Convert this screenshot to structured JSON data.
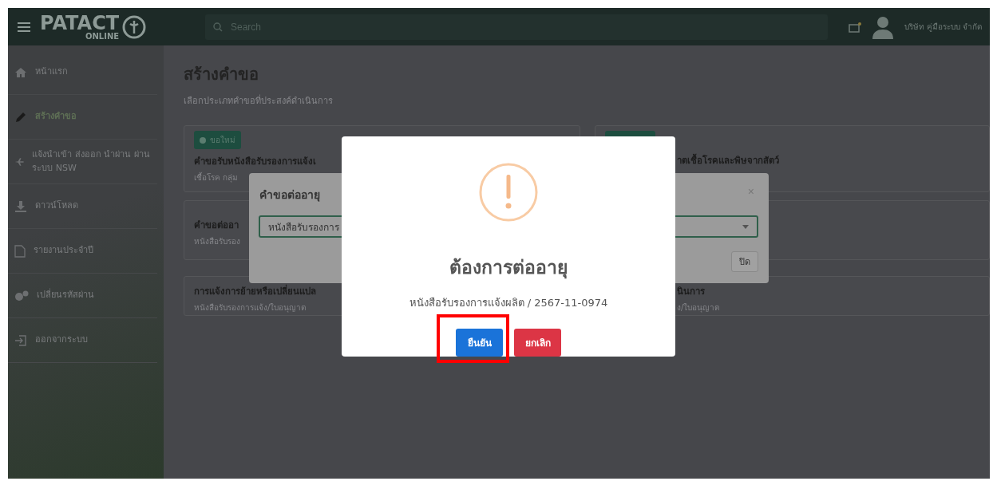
{
  "topbar": {
    "logo_text": "PATACT",
    "logo_subtext": "ONLINE",
    "search_placeholder": "Search",
    "user_name": "บริษัท คู่มือระบบ จำกัด"
  },
  "sidebar": {
    "items": [
      {
        "label": "หน้าแรก",
        "selected": false
      },
      {
        "label": "สร้างคำขอ",
        "selected": true
      },
      {
        "label": "แจ้งนำเข้า ส่งออก นำผ่าน ผ่านระบบ NSW",
        "selected": false
      },
      {
        "label": "ดาวน์โหลด",
        "selected": false
      },
      {
        "label": "รายงานประจำปี",
        "selected": false
      },
      {
        "label": "เปลี่ยนรหัสผ่าน",
        "selected": false
      },
      {
        "label": "ออกจากระบบ",
        "selected": false
      }
    ]
  },
  "page": {
    "title": "สร้างคำขอ",
    "subtitle": "เลือกประเภทคำขอที่ประสงค์ดำเนินการ"
  },
  "cards": [
    {
      "kind": "new",
      "badge": "ขอใหม่",
      "title": "คำขอรับหนังสือรับรองการแจ้งเ",
      "subtitle": "เชื้อโรค กลุ่ม"
    },
    {
      "kind": "new",
      "title": "าตเชื้อโรคและพิษจากสัตว์"
    },
    {
      "kind": "plain",
      "title": "คำขอต่ออา",
      "subtitle": "หนังสือรับรอง"
    },
    {
      "kind": "plain"
    },
    {
      "kind": "plain",
      "title": "การแจ้งการย้ายหรือเปลี่ยนแปล",
      "subtitle": "หนังสือรับรองการแจ้ง/ใบอนุญาต"
    },
    {
      "kind": "plain",
      "title": "นินการ",
      "subtitle": "ง/ใบอนุญาต"
    }
  ],
  "dialog_behind": {
    "title": "คำขอต่ออายุ",
    "close": "×",
    "select_value": "หนังสือรับรองการ",
    "footer_button": "ปิด"
  },
  "alert": {
    "title": "ต้องการต่ออายุ",
    "message": "หนังสือรับรองการแจ้งผลิต / 2567-11-0974",
    "confirm": "ยืนยัน",
    "cancel": "ยกเลิก"
  }
}
